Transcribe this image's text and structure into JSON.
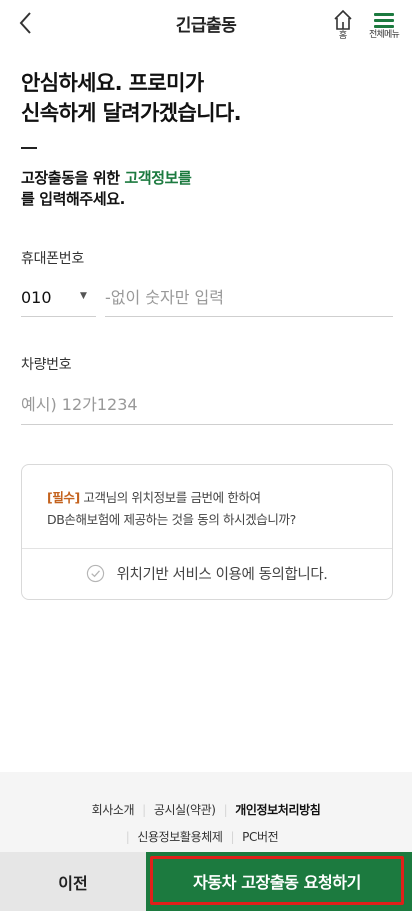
{
  "header": {
    "title": "긴급출동",
    "home_label": "홈",
    "menu_label": "전체메뉴"
  },
  "headline": {
    "line1": "안심하세요. 프로미가",
    "line2": "신속하게 달려가겠습니다."
  },
  "subtitle": {
    "prefix": "고장출동을 위한 ",
    "accent": "고객정보를",
    "suffix": "를 입력해주세요."
  },
  "form": {
    "phone_label": "휴대폰번호",
    "carrier_value": "010",
    "phone_placeholder": "-없이 숫자만 입력",
    "plate_label": "차량번호",
    "plate_placeholder": "예시) 12가1234"
  },
  "consent": {
    "required_tag": "[필수]",
    "text_line1": " 고객님의 위치정보를 금번에 한하여",
    "text_line2": "DB손해보험에 제공하는 것을 동의 하시겠습니까?",
    "checkbox_label": "위치기반 서비스 이용에 동의합니다."
  },
  "footer": {
    "links_row1": [
      "회사소개",
      "공시실(약관)",
      "개인정보처리방침"
    ],
    "links_row2": [
      "신용정보활용체제",
      "PC버전"
    ]
  },
  "buttons": {
    "prev_label": "이전",
    "request_label": "자동차 고장출동 요청하기"
  },
  "colors": {
    "brand_green": "#1c7a3f",
    "required_orange": "#c4621d",
    "highlight_red": "#e0201a"
  }
}
